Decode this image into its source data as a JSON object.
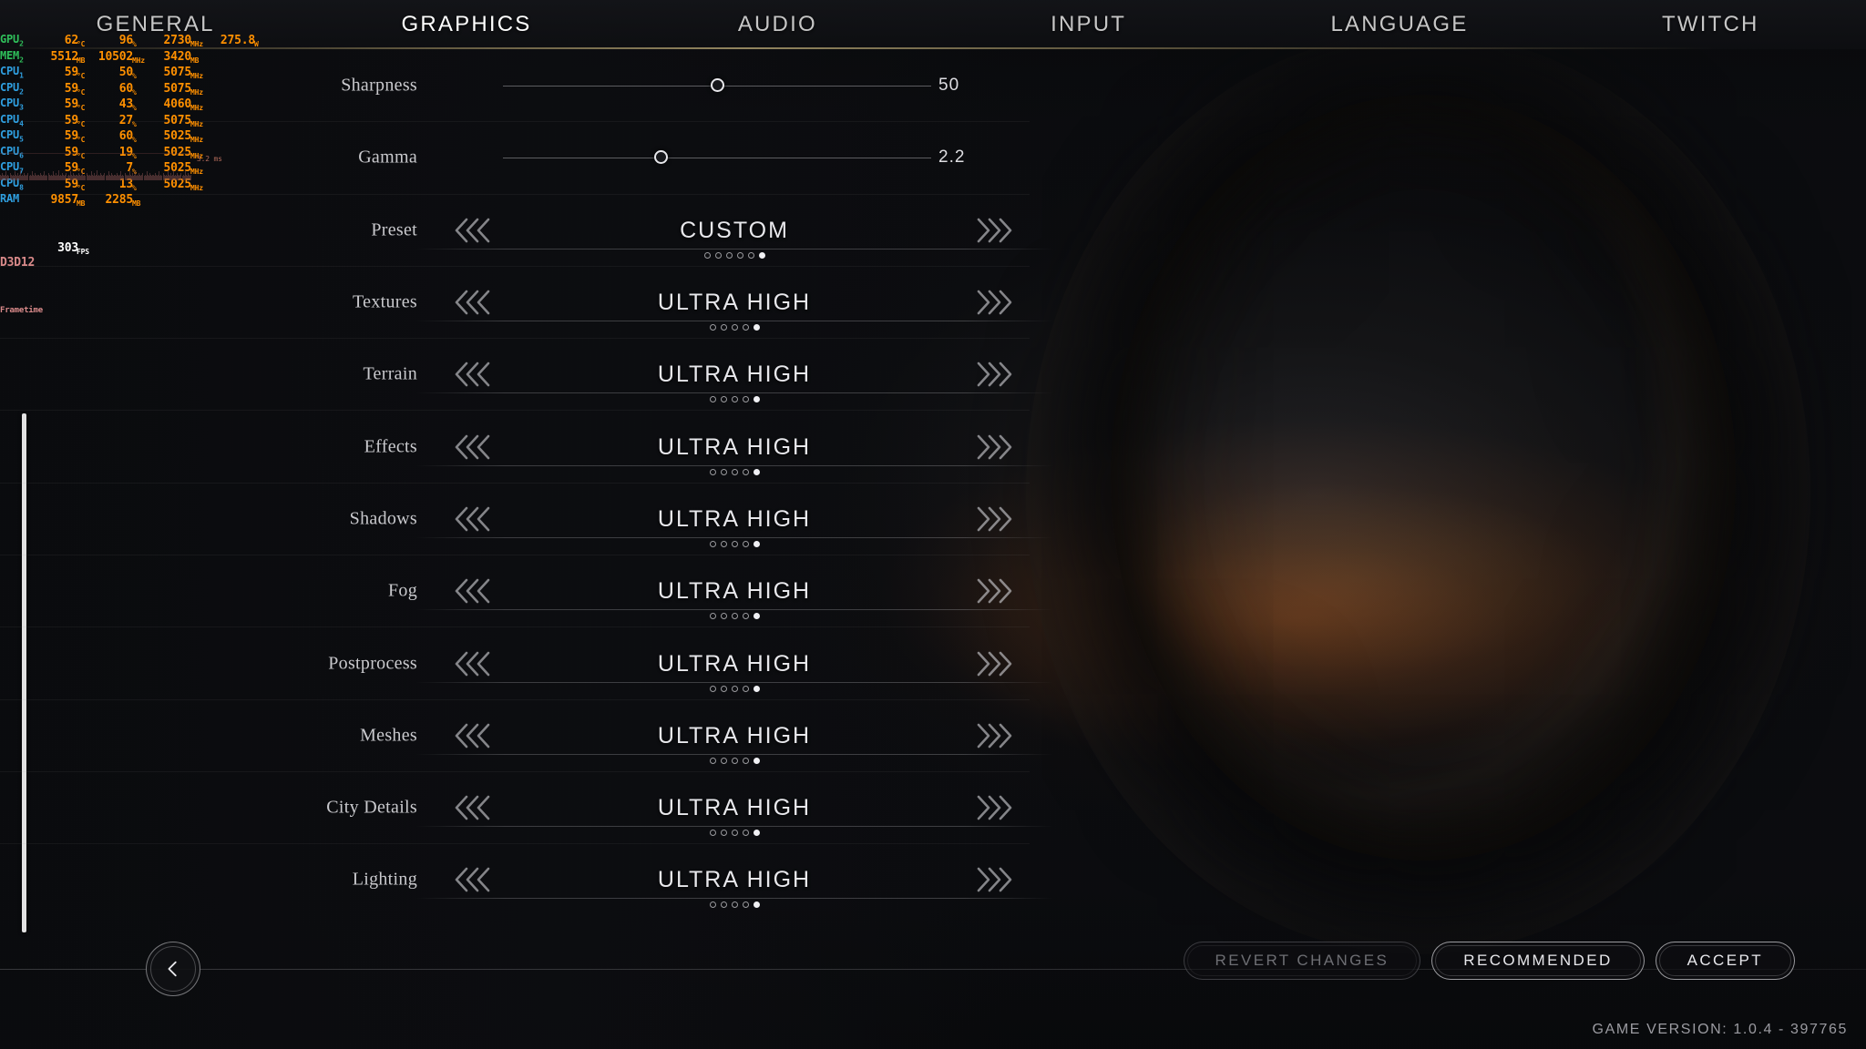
{
  "osd": {
    "rows": [
      {
        "label": "GPU",
        "sub": "2",
        "kind": "gpu",
        "c1": "62",
        "u1": "°C",
        "c2": "96",
        "u2": "%",
        "c3": "2730",
        "u3": "MHz",
        "c4": "275.8",
        "u4": "W"
      },
      {
        "label": "MEM",
        "sub": "2",
        "kind": "gpu",
        "c1": "5512",
        "u1": "MB",
        "c2": "10502",
        "u2": "MHz",
        "c3": "3420",
        "u3": "MB",
        "c4": "",
        "u4": ""
      },
      {
        "label": "CPU",
        "sub": "1",
        "kind": "cpu",
        "c1": "59",
        "u1": "°C",
        "c2": "50",
        "u2": "%",
        "c3": "5075",
        "u3": "MHz",
        "c4": "",
        "u4": ""
      },
      {
        "label": "CPU",
        "sub": "2",
        "kind": "cpu",
        "c1": "59",
        "u1": "°C",
        "c2": "60",
        "u2": "%",
        "c3": "5075",
        "u3": "MHz",
        "c4": "",
        "u4": ""
      },
      {
        "label": "CPU",
        "sub": "3",
        "kind": "cpu",
        "c1": "59",
        "u1": "°C",
        "c2": "43",
        "u2": "%",
        "c3": "4060",
        "u3": "MHz",
        "c4": "",
        "u4": ""
      },
      {
        "label": "CPU",
        "sub": "4",
        "kind": "cpu",
        "c1": "59",
        "u1": "°C",
        "c2": "27",
        "u2": "%",
        "c3": "5075",
        "u3": "MHz",
        "c4": "",
        "u4": ""
      },
      {
        "label": "CPU",
        "sub": "5",
        "kind": "cpu",
        "c1": "59",
        "u1": "°C",
        "c2": "60",
        "u2": "%",
        "c3": "5025",
        "u3": "MHz",
        "c4": "",
        "u4": ""
      },
      {
        "label": "CPU",
        "sub": "6",
        "kind": "cpu",
        "c1": "59",
        "u1": "°C",
        "c2": "19",
        "u2": "%",
        "c3": "5025",
        "u3": "MHz",
        "c4": "",
        "u4": ""
      },
      {
        "label": "CPU",
        "sub": "7",
        "kind": "cpu",
        "c1": "59",
        "u1": "°C",
        "c2": "7",
        "u2": "%",
        "c3": "5025",
        "u3": "MHz",
        "c4": "",
        "u4": ""
      },
      {
        "label": "CPU",
        "sub": "8",
        "kind": "cpu",
        "c1": "59",
        "u1": "°C",
        "c2": "13",
        "u2": "%",
        "c3": "5025",
        "u3": "MHz",
        "c4": "",
        "u4": ""
      },
      {
        "label": "RAM",
        "sub": "",
        "kind": "cpu",
        "c1": "9857",
        "u1": "MB",
        "c2": "2285",
        "u2": "MB",
        "c3": "",
        "u3": "",
        "c4": "",
        "u4": ""
      }
    ],
    "api_label": "D3D12",
    "fps_value": "303",
    "fps_unit": "FPS",
    "frametime_label": "Frametime",
    "frametime_scale": "3.2 ms"
  },
  "tabs": [
    {
      "label": "GENERAL",
      "active": false
    },
    {
      "label": "GRAPHICS",
      "active": true
    },
    {
      "label": "AUDIO",
      "active": false
    },
    {
      "label": "INPUT",
      "active": false
    },
    {
      "label": "LANGUAGE",
      "active": false
    },
    {
      "label": "TWITCH",
      "active": false
    }
  ],
  "settings": [
    {
      "type": "slider",
      "label": "Sharpness",
      "value": "50",
      "percent": 50
    },
    {
      "type": "slider",
      "label": "Gamma",
      "value": "2.2",
      "percent": 37
    },
    {
      "type": "option",
      "label": "Preset",
      "value": "CUSTOM",
      "dots": 6,
      "selected": 6
    },
    {
      "type": "option",
      "label": "Textures",
      "value": "ULTRA HIGH",
      "dots": 5,
      "selected": 5
    },
    {
      "type": "option",
      "label": "Terrain",
      "value": "ULTRA HIGH",
      "dots": 5,
      "selected": 5
    },
    {
      "type": "option",
      "label": "Effects",
      "value": "ULTRA HIGH",
      "dots": 5,
      "selected": 5
    },
    {
      "type": "option",
      "label": "Shadows",
      "value": "ULTRA HIGH",
      "dots": 5,
      "selected": 5
    },
    {
      "type": "option",
      "label": "Fog",
      "value": "ULTRA HIGH",
      "dots": 5,
      "selected": 5
    },
    {
      "type": "option",
      "label": "Postprocess",
      "value": "ULTRA HIGH",
      "dots": 5,
      "selected": 5
    },
    {
      "type": "option",
      "label": "Meshes",
      "value": "ULTRA HIGH",
      "dots": 5,
      "selected": 5
    },
    {
      "type": "option",
      "label": "City Details",
      "value": "ULTRA HIGH",
      "dots": 5,
      "selected": 5
    },
    {
      "type": "option",
      "label": "Lighting",
      "value": "ULTRA HIGH",
      "dots": 5,
      "selected": 5
    }
  ],
  "bottom": {
    "back_icon": "chevron-left-icon",
    "buttons": [
      {
        "label": "REVERT CHANGES",
        "disabled": true
      },
      {
        "label": "RECOMMENDED",
        "disabled": false
      },
      {
        "label": "ACCEPT",
        "disabled": false
      }
    ],
    "version": "GAME VERSION: 1.0.4 - 397765"
  },
  "colors": {
    "osd_value": "#ff9000",
    "osd_gpu_label": "#2fbf5a",
    "osd_cpu_label": "#2f9fe0",
    "tab_glow": "#a39263",
    "text_primary": "#e8e8ec"
  }
}
